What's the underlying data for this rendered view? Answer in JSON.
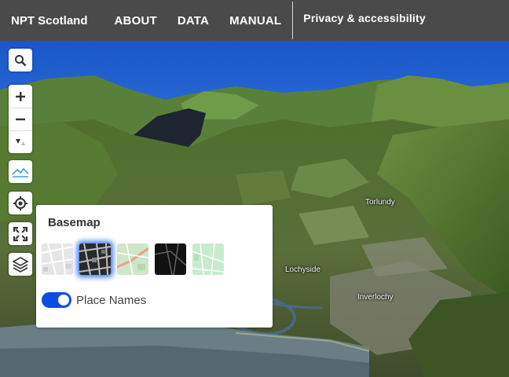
{
  "header": {
    "brand": "NPT Scotland",
    "nav": [
      "ABOUT",
      "DATA",
      "MANUAL"
    ],
    "privacy": "Privacy & accessibility"
  },
  "map": {
    "places": [
      {
        "name": "Torlundy"
      },
      {
        "name": "Lochyside"
      },
      {
        "name": "Inverlochy"
      }
    ],
    "controls": [
      "search-icon",
      "zoom-in-icon",
      "zoom-out-icon",
      "compass-icon",
      "terrain-icon",
      "geolocate-icon",
      "fullscreen-icon",
      "layers-icon"
    ]
  },
  "basemap_panel": {
    "title": "Basemap",
    "options": [
      {
        "name": "grey-basemap",
        "active": false
      },
      {
        "name": "satellite-basemap",
        "active": true
      },
      {
        "name": "streets-basemap",
        "active": false
      },
      {
        "name": "dark-basemap",
        "active": false
      },
      {
        "name": "light-green-basemap",
        "active": false
      }
    ],
    "place_names_label": "Place Names",
    "place_names_on": true
  },
  "colors": {
    "header_bg": "#4a4a4a",
    "toggle_on": "#0b4fe0",
    "sky": "#1b5fd0"
  }
}
